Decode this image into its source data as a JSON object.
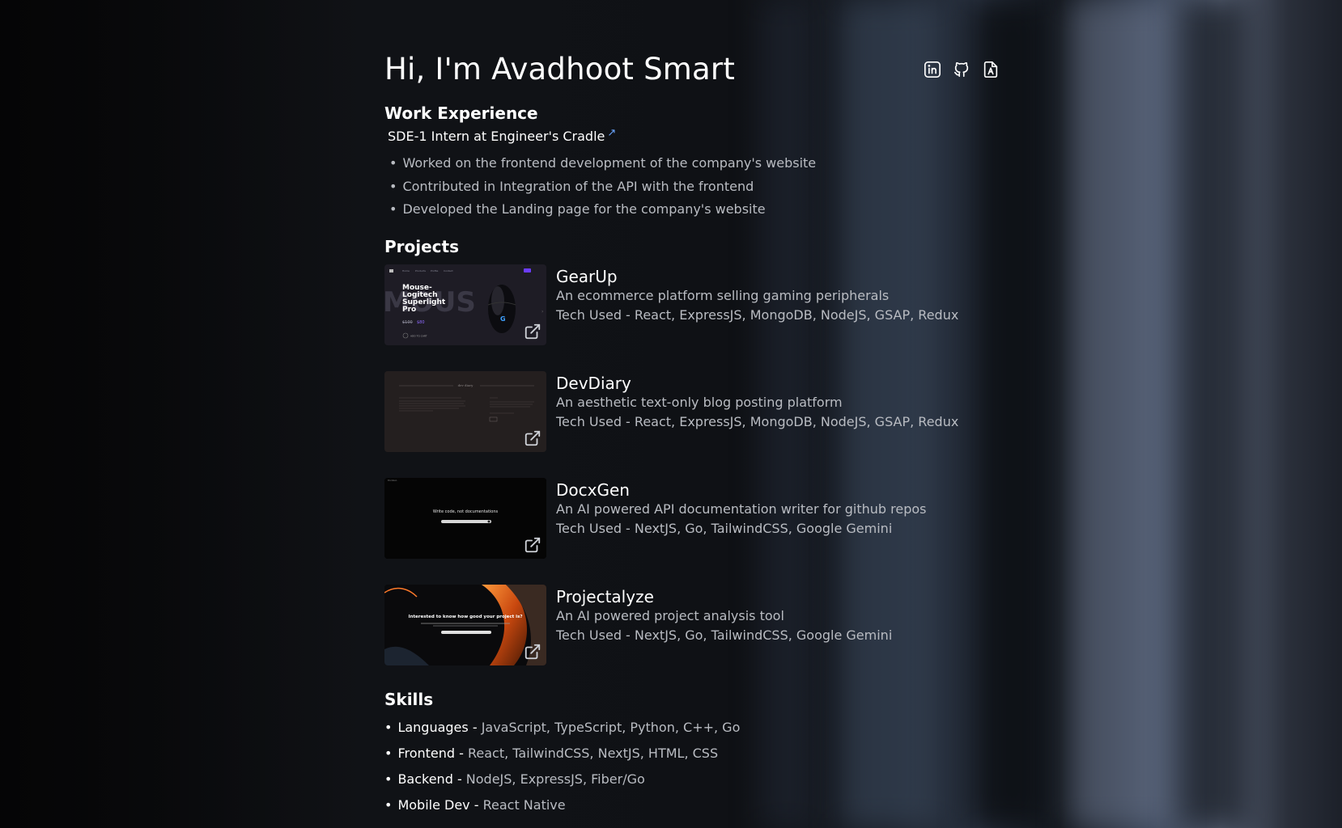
{
  "hero": {
    "title": "Hi, I'm Avadhoot Smart"
  },
  "socials": [
    "linkedin-icon",
    "github-icon",
    "resume-icon"
  ],
  "work": {
    "heading": "Work Experience",
    "role": "SDE-1 Intern at Engineer's Cradle",
    "link_icon": "↗",
    "bullets": [
      "Worked on the frontend development of the company's website",
      "Contributed in Integration of the API with the frontend",
      "Developed the Landing page for the company's website"
    ]
  },
  "projects": {
    "heading": "Projects",
    "items": [
      {
        "name": "GearUp",
        "desc": "An ecommerce platform selling gaming peripherals",
        "tech": "Tech Used - React, ExpressJS, MongoDB, NodeJS, GSAP, Redux",
        "thumb": {
          "headline": [
            "Mouse-",
            "Logitech",
            "Superlight",
            "Pro"
          ],
          "old_price": "$100",
          "new_price": "$80",
          "bg_word": "MOUS",
          "cart": "ADD TO CART"
        }
      },
      {
        "name": "DevDiary",
        "desc": "An aesthetic text-only blog posting platform",
        "tech": "Tech Used - React, ExpressJS, MongoDB, NodeJS, GSAP, Redux",
        "thumb": {
          "brand": "dev diary"
        }
      },
      {
        "name": "DocxGen",
        "desc": "An AI powered API documentation writer for github repos",
        "tech": "Tech Used - NextJS, Go, TailwindCSS, Google Gemini",
        "thumb": {
          "headline": "Write code, not documentations",
          "brand": "DocxGen"
        }
      },
      {
        "name": "Projectalyze",
        "desc": "An AI powered project analysis tool",
        "tech": "Tech Used - NextJS, Go, TailwindCSS, Google Gemini",
        "thumb": {
          "headline": "Interested to know how good your project is?"
        }
      }
    ]
  },
  "skills": {
    "heading": "Skills",
    "items": [
      {
        "key": "Languages - ",
        "value": "JavaScript, TypeScript, Python, C++, Go"
      },
      {
        "key": "Frontend - ",
        "value": "React, TailwindCSS, NextJS, HTML, CSS"
      },
      {
        "key": "Backend - ",
        "value": "NodeJS, ExpressJS, Fiber/Go"
      },
      {
        "key": "Mobile Dev - ",
        "value": "React Native"
      }
    ]
  },
  "colors": {
    "link_accent": "#6aa5ff",
    "muted_text": "#b9bcc2",
    "gearup_accent": "#6c3cff"
  }
}
